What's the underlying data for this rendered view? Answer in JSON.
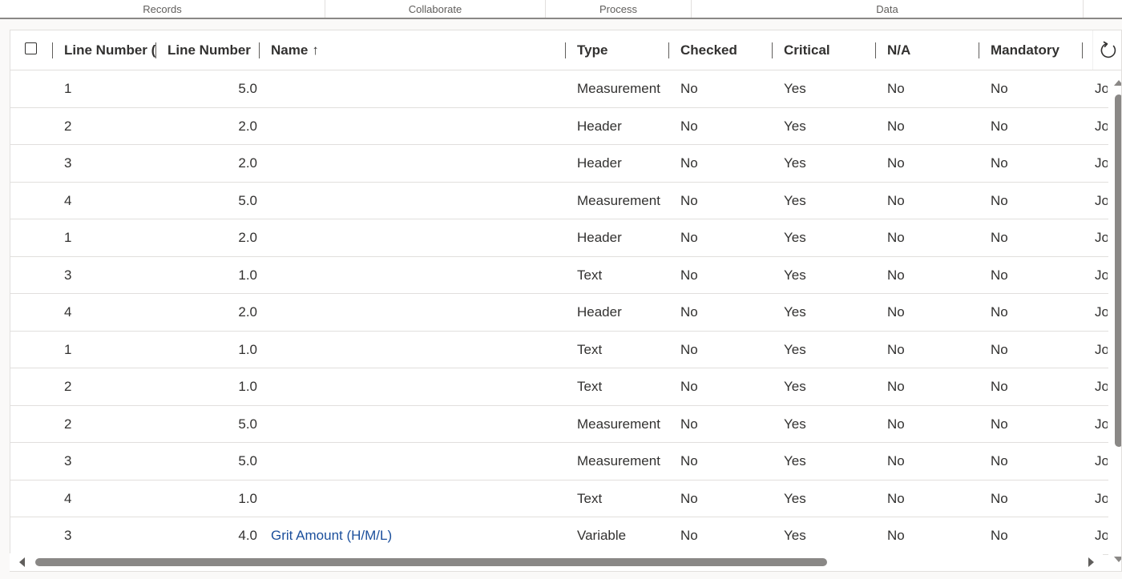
{
  "ribbon": {
    "groups": [
      "Records",
      "Collaborate",
      "Process",
      "Data"
    ]
  },
  "grid": {
    "columns": {
      "line_number_m": "Line Number (M",
      "line_number": "Line Number",
      "name": "Name",
      "name_sort": "↑",
      "type": "Type",
      "checked": "Checked",
      "critical": "Critical",
      "na": "N/A",
      "mandatory": "Mandatory"
    },
    "rows": [
      {
        "ln_m": "1",
        "ln": "5.0",
        "name": "",
        "type": "Measurement",
        "checked": "No",
        "critical": "Yes",
        "na": "No",
        "mandatory": "No",
        "extra": "Jo"
      },
      {
        "ln_m": "2",
        "ln": "2.0",
        "name": "",
        "type": "Header",
        "checked": "No",
        "critical": "Yes",
        "na": "No",
        "mandatory": "No",
        "extra": "Jo"
      },
      {
        "ln_m": "3",
        "ln": "2.0",
        "name": "",
        "type": "Header",
        "checked": "No",
        "critical": "Yes",
        "na": "No",
        "mandatory": "No",
        "extra": "Jo"
      },
      {
        "ln_m": "4",
        "ln": "5.0",
        "name": "",
        "type": "Measurement",
        "checked": "No",
        "critical": "Yes",
        "na": "No",
        "mandatory": "No",
        "extra": "Jo"
      },
      {
        "ln_m": "1",
        "ln": "2.0",
        "name": "",
        "type": "Header",
        "checked": "No",
        "critical": "Yes",
        "na": "No",
        "mandatory": "No",
        "extra": "Jo"
      },
      {
        "ln_m": "3",
        "ln": "1.0",
        "name": "",
        "type": "Text",
        "checked": "No",
        "critical": "Yes",
        "na": "No",
        "mandatory": "No",
        "extra": "Jo"
      },
      {
        "ln_m": "4",
        "ln": "2.0",
        "name": "",
        "type": "Header",
        "checked": "No",
        "critical": "Yes",
        "na": "No",
        "mandatory": "No",
        "extra": "Jo"
      },
      {
        "ln_m": "1",
        "ln": "1.0",
        "name": "",
        "type": "Text",
        "checked": "No",
        "critical": "Yes",
        "na": "No",
        "mandatory": "No",
        "extra": "Jo"
      },
      {
        "ln_m": "2",
        "ln": "1.0",
        "name": "",
        "type": "Text",
        "checked": "No",
        "critical": "Yes",
        "na": "No",
        "mandatory": "No",
        "extra": "Jo"
      },
      {
        "ln_m": "2",
        "ln": "5.0",
        "name": "",
        "type": "Measurement",
        "checked": "No",
        "critical": "Yes",
        "na": "No",
        "mandatory": "No",
        "extra": "Jo"
      },
      {
        "ln_m": "3",
        "ln": "5.0",
        "name": "",
        "type": "Measurement",
        "checked": "No",
        "critical": "Yes",
        "na": "No",
        "mandatory": "No",
        "extra": "Jo"
      },
      {
        "ln_m": "4",
        "ln": "1.0",
        "name": "",
        "type": "Text",
        "checked": "No",
        "critical": "Yes",
        "na": "No",
        "mandatory": "No",
        "extra": "Jo"
      },
      {
        "ln_m": "3",
        "ln": "4.0",
        "name": "Grit Amount (H/M/L)",
        "type": "Variable",
        "checked": "No",
        "critical": "Yes",
        "na": "No",
        "mandatory": "No",
        "extra": "Jo"
      }
    ]
  },
  "icons": {
    "refresh": "refresh-icon",
    "select_all": "checkbox-icon"
  },
  "colors": {
    "link": "#1b4f9c",
    "text": "#323130",
    "border": "#e1dfdd",
    "scrollbar": "#8a8886"
  }
}
